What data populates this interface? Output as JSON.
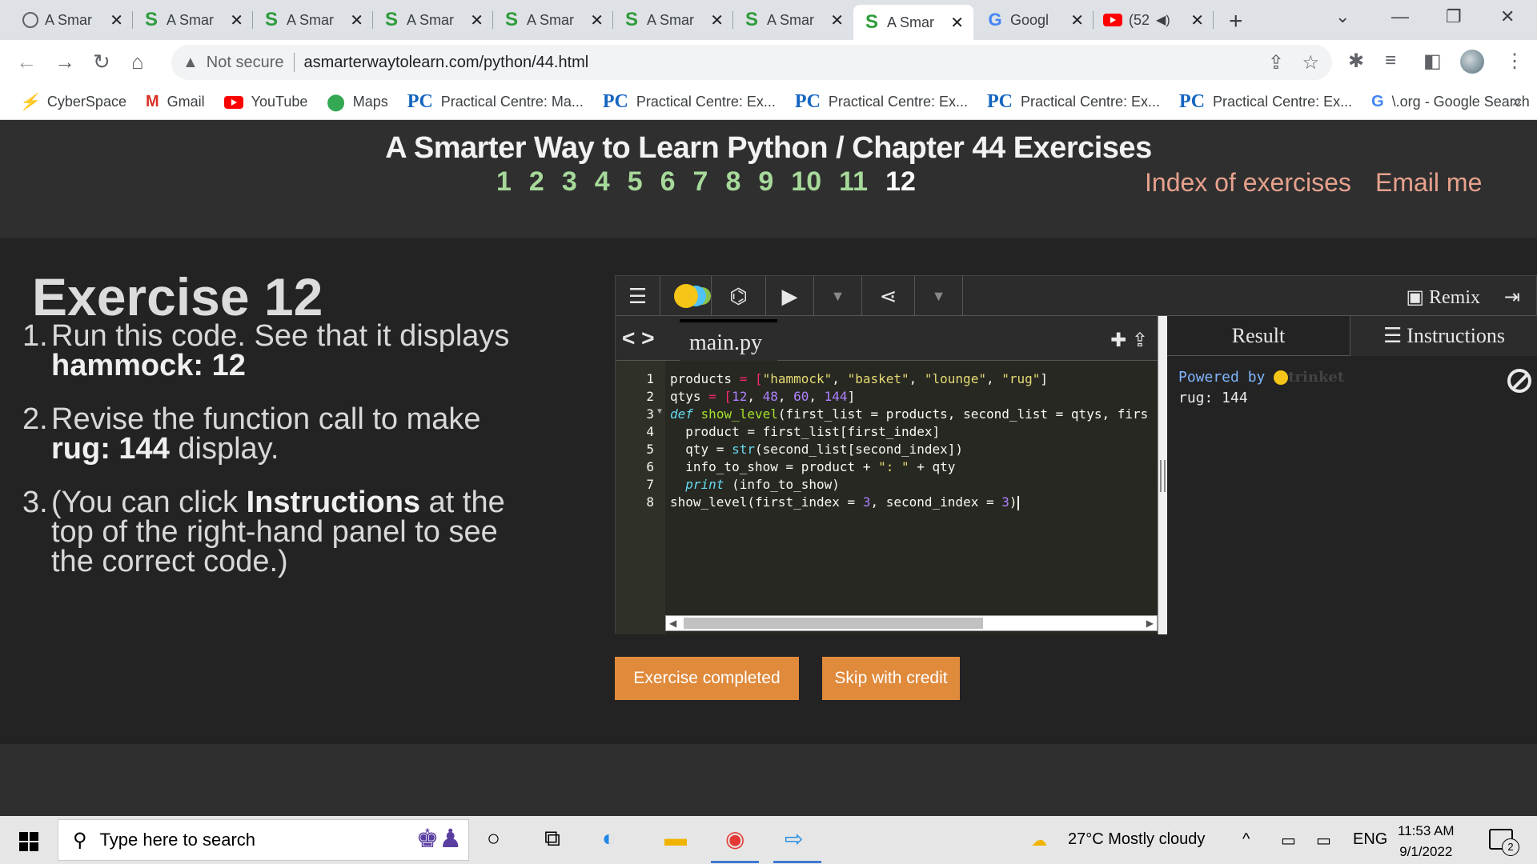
{
  "browser": {
    "tabs": [
      {
        "label": "A Smar",
        "icon": "globe-icon"
      },
      {
        "label": "A Smar",
        "icon": "s-logo-icon"
      },
      {
        "label": "A Smar",
        "icon": "s-logo-icon"
      },
      {
        "label": "A Smar",
        "icon": "s-logo-icon"
      },
      {
        "label": "A Smar",
        "icon": "s-logo-icon"
      },
      {
        "label": "A Smar",
        "icon": "s-logo-icon"
      },
      {
        "label": "A Smar",
        "icon": "s-logo-icon"
      },
      {
        "label": "A Smar",
        "icon": "s-logo-icon",
        "active": true
      },
      {
        "label": "Googl",
        "icon": "google-icon"
      },
      {
        "label": "(52",
        "icon": "youtube-icon"
      }
    ],
    "omnibox": {
      "security": "Not secure",
      "url": "asmarterwaytolearn.com/python/44.html"
    },
    "bookmarks": [
      {
        "label": "CyberSpace",
        "icon": "cyberspace-icon"
      },
      {
        "label": "Gmail",
        "icon": "gmail-icon"
      },
      {
        "label": "YouTube",
        "icon": "youtube-icon"
      },
      {
        "label": "Maps",
        "icon": "maps-icon"
      },
      {
        "label": "Practical Centre: Ma...",
        "icon": "pc-icon"
      },
      {
        "label": "Practical Centre: Ex...",
        "icon": "pc-icon"
      },
      {
        "label": "Practical Centre: Ex...",
        "icon": "pc-icon"
      },
      {
        "label": "Practical Centre: Ex...",
        "icon": "pc-icon"
      },
      {
        "label": "Practical Centre: Ex...",
        "icon": "pc-icon"
      },
      {
        "label": "\\.org - Google Search",
        "icon": "google-icon"
      }
    ]
  },
  "site": {
    "title": "A Smarter Way to Learn Python / Chapter 44 Exercises",
    "exercise_numbers": [
      "1",
      "2",
      "3",
      "4",
      "5",
      "6",
      "7",
      "8",
      "9",
      "10",
      "11",
      "12"
    ],
    "current_exercise": "12",
    "index_link": "Index of exercises",
    "email_link": "Email me",
    "link_color": "#e7a18d",
    "number_color": "#a6d99a"
  },
  "exercise": {
    "title": "Exercise 12",
    "items": [
      {
        "num": "1.",
        "pre": "Run this code. See that it displays ",
        "bold": "hammock: 12",
        "post": ""
      },
      {
        "num": "2.",
        "pre": "Revise the function call to make ",
        "bold": "rug: 144",
        "post": " display."
      },
      {
        "num": "3.",
        "pre": "(You can click ",
        "bold": "Instructions",
        "post": " at the top of the right-hand panel to see the correct code.)"
      }
    ],
    "buttons": {
      "completed": "Exercise completed",
      "skip": "Skip with credit"
    },
    "button_color": "#e08a3c"
  },
  "trinket": {
    "remix_label": "Remix",
    "file_name": "main.py",
    "code_lines": [
      {
        "n": "1",
        "fold": false
      },
      {
        "n": "2",
        "fold": false
      },
      {
        "n": "3",
        "fold": true
      },
      {
        "n": "4",
        "fold": false
      },
      {
        "n": "5",
        "fold": false
      },
      {
        "n": "6",
        "fold": false
      },
      {
        "n": "7",
        "fold": false
      },
      {
        "n": "8",
        "fold": false
      }
    ],
    "code": {
      "l1": {
        "a": "products",
        "b": " = [",
        "c": "\"hammock\"",
        "d": ", ",
        "e": "\"basket\"",
        "f": ", ",
        "g": "\"lounge\"",
        "h": ", ",
        "i": "\"rug\"",
        "j": "]"
      },
      "l2": {
        "a": "qtys",
        "b": " = [",
        "c": "12",
        "d": ", ",
        "e": "48",
        "f": ", ",
        "g": "60",
        "h": ", ",
        "i": "144",
        "j": "]"
      },
      "l3": {
        "kw": "def",
        "fn": "show_level",
        "rest1": "(first_list = products, second_list = qtys, firs"
      },
      "l4": "  product = first_list[first_index]",
      "l5": {
        "a": "  qty = ",
        "bi": "str",
        "b": "(second_list[second_index])"
      },
      "l6": {
        "a": "  info_to_show = product + ",
        "st": "\": \"",
        "b": " + qty"
      },
      "l7": {
        "kw": "  print",
        "b": " (info_to_show)"
      },
      "l8": {
        "a": "show_level(first_index = ",
        "n1": "3",
        "b": ", second_index = ",
        "n2": "3",
        "c": ")"
      }
    },
    "result_tab": "Result",
    "instructions_tab": "Instructions",
    "powered_by": "Powered by",
    "brand": "trinket",
    "output": "rug: 144"
  },
  "taskbar": {
    "search_placeholder": "Type here to search",
    "weather": "27°C  Mostly cloudy",
    "language": "ENG",
    "time": "11:53 AM",
    "date": "9/1/2022",
    "notifications": "2"
  }
}
